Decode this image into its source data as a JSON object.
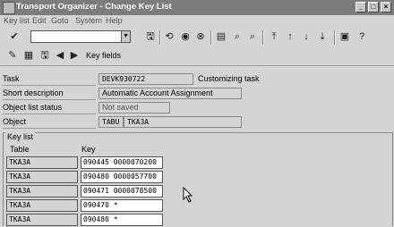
{
  "window": {
    "title": "Transport Organizer - Change Key List",
    "controls": [
      "_",
      "□",
      "×"
    ]
  },
  "menu": [
    "Key list",
    "Edit",
    "Goto",
    "System",
    "Help"
  ],
  "toolbar1": {
    "icons": [
      "check-icon",
      "save-icon",
      "back-icon",
      "exit-icon",
      "cancel-icon",
      "print-icon",
      "find-icon",
      "find-next-icon",
      "first-page-icon",
      "prev-page-icon",
      "next-page-icon",
      "last-page-icon",
      "new-session-icon",
      "help-icon"
    ]
  },
  "toolbar2": {
    "icons": [
      "edit-pen-icon",
      "display-icon",
      "save-list-icon",
      "prev-icon",
      "next-icon"
    ],
    "key_fields_label": "Key fields"
  },
  "fields": {
    "task": {
      "label": "Task",
      "value": "DEVK930722",
      "extra": "Customizing task"
    },
    "short_description": {
      "label": "Short description",
      "value": "Automatic Account Assignment"
    },
    "object_list_status": {
      "label": "Object list status",
      "value": "Not saved"
    },
    "object": {
      "label": "Object",
      "value1": "TABU",
      "value2": "TKA3A"
    }
  },
  "key_list": {
    "title": "Key list",
    "col_table": "Table",
    "col_key": "Key",
    "rows": [
      {
        "table": "TKA3A",
        "key": "090445 0000070200"
      },
      {
        "table": "TKA3A",
        "key": "090480 0000057700"
      },
      {
        "table": "TKA3A",
        "key": "090471 0000078500"
      },
      {
        "table": "TKA3A",
        "key": "090470 *"
      },
      {
        "table": "TKA3A",
        "key": "090480 *"
      }
    ]
  }
}
